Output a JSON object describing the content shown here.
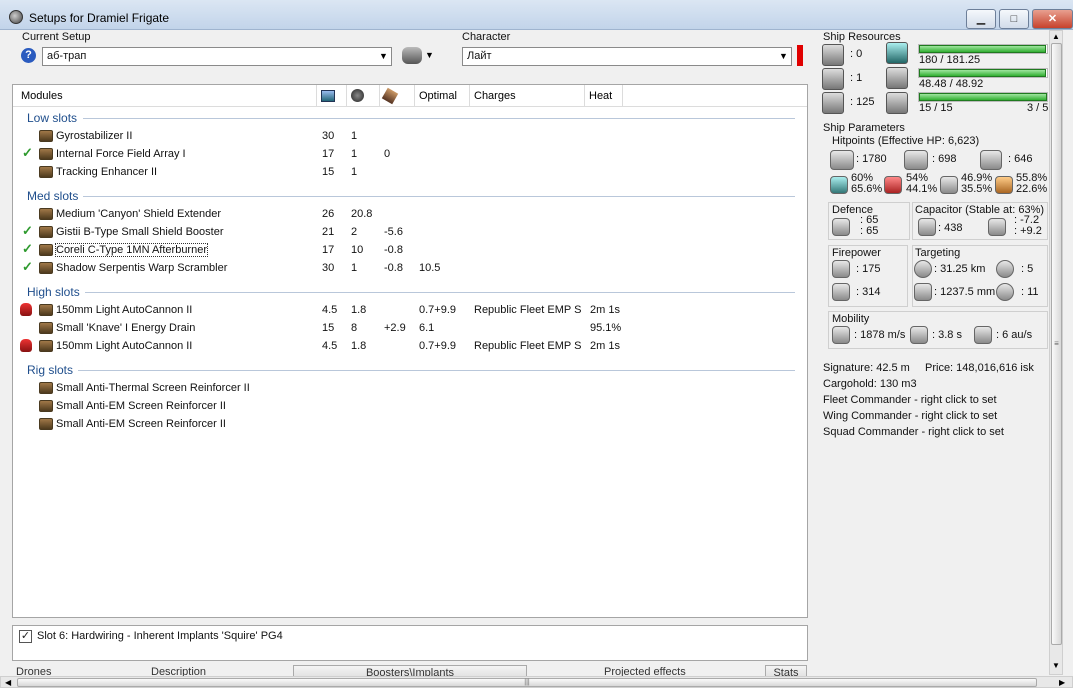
{
  "window": {
    "title": "Setups for Dramiel Frigate",
    "min": "▁",
    "max": "□",
    "close": "✕"
  },
  "setup": {
    "label": "Current Setup",
    "value": "аб-трап",
    "help": "?"
  },
  "character": {
    "label": "Character",
    "value": "Лайт"
  },
  "table": {
    "headers": {
      "modules": "Modules",
      "optimal": "Optimal",
      "charges": "Charges",
      "heat": "Heat"
    },
    "sections": {
      "low": "Low slots",
      "med": "Med slots",
      "high": "High slots",
      "rig": "Rig slots"
    },
    "low": [
      {
        "name": "Gyrostabilizer II",
        "c1": "30",
        "c2": "1",
        "c3": "",
        "optimal": "",
        "charges": "",
        "heat": ""
      },
      {
        "name": "Internal Force Field Array I",
        "c1": "17",
        "c2": "1",
        "c3": "0",
        "optimal": "",
        "charges": "",
        "heat": ""
      },
      {
        "name": "Tracking Enhancer II",
        "c1": "15",
        "c2": "1",
        "c3": "",
        "optimal": "",
        "charges": "",
        "heat": ""
      }
    ],
    "med": [
      {
        "name": "Medium 'Canyon' Shield Extender",
        "c1": "26",
        "c2": "20.8",
        "c3": "",
        "optimal": "",
        "charges": "",
        "heat": ""
      },
      {
        "name": "Gistii B-Type Small Shield Booster",
        "c1": "21",
        "c2": "2",
        "c3": "-5.6",
        "optimal": "",
        "charges": "",
        "heat": ""
      },
      {
        "name": "Coreli C-Type 1MN Afterburner",
        "c1": "17",
        "c2": "10",
        "c3": "-0.8",
        "optimal": "",
        "charges": "",
        "heat": ""
      },
      {
        "name": "Shadow Serpentis Warp Scrambler",
        "c1": "30",
        "c2": "1",
        "c3": "-0.8",
        "optimal": "10.5",
        "charges": "",
        "heat": ""
      }
    ],
    "high": [
      {
        "name": "150mm Light AutoCannon II",
        "c1": "4.5",
        "c2": "1.8",
        "c3": "",
        "optimal": "0.7+9.9",
        "charges": "Republic Fleet EMP S",
        "heat": "2m 1s"
      },
      {
        "name": "Small 'Knave' I Energy Drain",
        "c1": "15",
        "c2": "8",
        "c3": "+2.9",
        "optimal": "6.1",
        "charges": "",
        "heat": "95.1%"
      },
      {
        "name": "150mm Light AutoCannon II",
        "c1": "4.5",
        "c2": "1.8",
        "c3": "",
        "optimal": "0.7+9.9",
        "charges": "Republic Fleet EMP S",
        "heat": "2m 1s"
      }
    ],
    "rig": [
      {
        "name": "Small Anti-Thermal Screen Reinforcer II"
      },
      {
        "name": "Small Anti-EM Screen Reinforcer II"
      },
      {
        "name": "Small Anti-EM Screen Reinforcer II"
      }
    ]
  },
  "implant": {
    "text": "Slot 6: Hardwiring - Inherent Implants 'Squire' PG4",
    "checked": true
  },
  "bottom_tabs": {
    "drones": "Drones",
    "description": "Description",
    "boosters": "Boosters\\Implants",
    "projected": "Projected effects",
    "stats": "Stats"
  },
  "resources": {
    "title": "Ship Resources",
    "turret": ": 0",
    "launcher": ": 1",
    "drone_bw": ": 125",
    "cpu": "180 / 181.25",
    "cpu_fill": 0.993,
    "power": "48.48 / 48.92",
    "power_fill": 0.991,
    "calibration": "15 / 15",
    "calibration_right": "3 / 5",
    "calibration_fill": 1.0
  },
  "params": {
    "title": "Ship Parameters",
    "hitpoints": "Hitpoints (Effective HP: 6,623)",
    "shield_hp": ": 1780",
    "armor_hp": ": 698",
    "struct_hp": ": 646",
    "res": [
      {
        "a": "60%",
        "b": "65.6%"
      },
      {
        "a": "54%",
        "b": "44.1%"
      },
      {
        "a": "46.9%",
        "b": "35.5%"
      },
      {
        "a": "55.8%",
        "b": "22.6%"
      }
    ],
    "defence": "Defence",
    "def1": ": 65",
    "def2": ": 65",
    "capacitor": "Capacitor (Stable at: 63%)",
    "cap_val": ": 438",
    "cap_a": ": -7.2",
    "cap_b": ": +9.2",
    "firepower": "Firepower",
    "fp1": ": 175",
    "fp2": ": 314",
    "targeting": "Targeting",
    "range": ": 31.25 km",
    "targets": ": 5",
    "scanres": ": 1237.5 mm",
    "sensor": ": 11",
    "mobility": "Mobility",
    "speed": ": 1878 m/s",
    "align": ": 3.8 s",
    "warp": ": 6 au/s",
    "signature": "Signature: 42.5 m",
    "price": "Price: 148,016,616 isk",
    "cargo": "Cargohold: 130 m3",
    "fleet": "Fleet Commander - right click to set",
    "wing": "Wing Commander - right click to set",
    "squad": "Squad Commander - right click to set"
  },
  "colors": {
    "accent": "#1f4e8c",
    "bar": "#32b032",
    "warn": "#e00000"
  }
}
